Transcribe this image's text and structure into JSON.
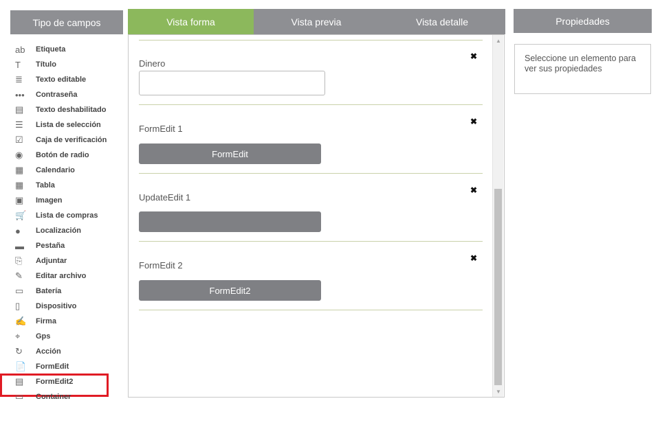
{
  "left_panel": {
    "header": "Tipo de campos",
    "items": [
      {
        "icon": "text-label-icon",
        "glyph": "ab",
        "label": "Etiqueta"
      },
      {
        "icon": "title-icon",
        "glyph": "T",
        "label": "Título"
      },
      {
        "icon": "editable-text-icon",
        "glyph": "≣",
        "label": "Texto editable"
      },
      {
        "icon": "password-icon",
        "glyph": "•••",
        "label": "Contraseña"
      },
      {
        "icon": "disabled-text-icon",
        "glyph": "▤",
        "label": "Texto deshabilitado"
      },
      {
        "icon": "selection-list-icon",
        "glyph": "☰",
        "label": "Lista de selección"
      },
      {
        "icon": "checkbox-icon",
        "glyph": "☑",
        "label": "Caja de verificación"
      },
      {
        "icon": "radio-button-icon",
        "glyph": "◉",
        "label": "Botón de radio"
      },
      {
        "icon": "calendar-icon",
        "glyph": "▦",
        "label": "Calendario"
      },
      {
        "icon": "table-icon",
        "glyph": "▦",
        "label": "Tabla"
      },
      {
        "icon": "image-icon",
        "glyph": "▣",
        "label": "Imagen"
      },
      {
        "icon": "shopping-cart-icon",
        "glyph": "🛒",
        "label": "Lista de compras"
      },
      {
        "icon": "location-pin-icon",
        "glyph": "●",
        "label": "Localización"
      },
      {
        "icon": "tab-folder-icon",
        "glyph": "▬",
        "label": "Pestaña"
      },
      {
        "icon": "attach-icon",
        "glyph": "⎘",
        "label": "Adjuntar"
      },
      {
        "icon": "edit-file-icon",
        "glyph": "✎",
        "label": "Editar archivo"
      },
      {
        "icon": "battery-icon",
        "glyph": "▭",
        "label": "Batería"
      },
      {
        "icon": "device-icon",
        "glyph": "▯",
        "label": "Dispositivo"
      },
      {
        "icon": "signature-icon",
        "glyph": "✍",
        "label": "Firma"
      },
      {
        "icon": "gps-icon",
        "glyph": "⌖",
        "label": "Gps"
      },
      {
        "icon": "action-icon",
        "glyph": "↻",
        "label": "Acción"
      },
      {
        "icon": "formedit-icon",
        "glyph": "📄",
        "label": "FormEdit"
      },
      {
        "icon": "formedit2-icon",
        "glyph": "▤",
        "label": "FormEdit2"
      },
      {
        "icon": "container-icon",
        "glyph": "▭",
        "label": "Container"
      }
    ]
  },
  "tabs": [
    {
      "label": "Vista forma",
      "active": true
    },
    {
      "label": "Vista previa",
      "active": false
    },
    {
      "label": "Vista detalle",
      "active": false
    }
  ],
  "form": {
    "rows": [
      {
        "label": "Dinero",
        "widget": "input",
        "value": ""
      },
      {
        "label": "FormEdit 1",
        "widget": "button",
        "button_text": "FormEdit"
      },
      {
        "label": "UpdateEdit 1",
        "widget": "button",
        "button_text": ""
      },
      {
        "label": "FormEdit 2",
        "widget": "button",
        "button_text": "FormEdit2"
      }
    ],
    "close_glyph": "✖"
  },
  "right_panel": {
    "header": "Propiedades",
    "message": "Seleccione un elemento para ver sus propiedades"
  },
  "colors": {
    "active_tab": "#8cb85c",
    "inactive_tab": "#8e8f93",
    "selection_highlight": "#e01b24"
  }
}
